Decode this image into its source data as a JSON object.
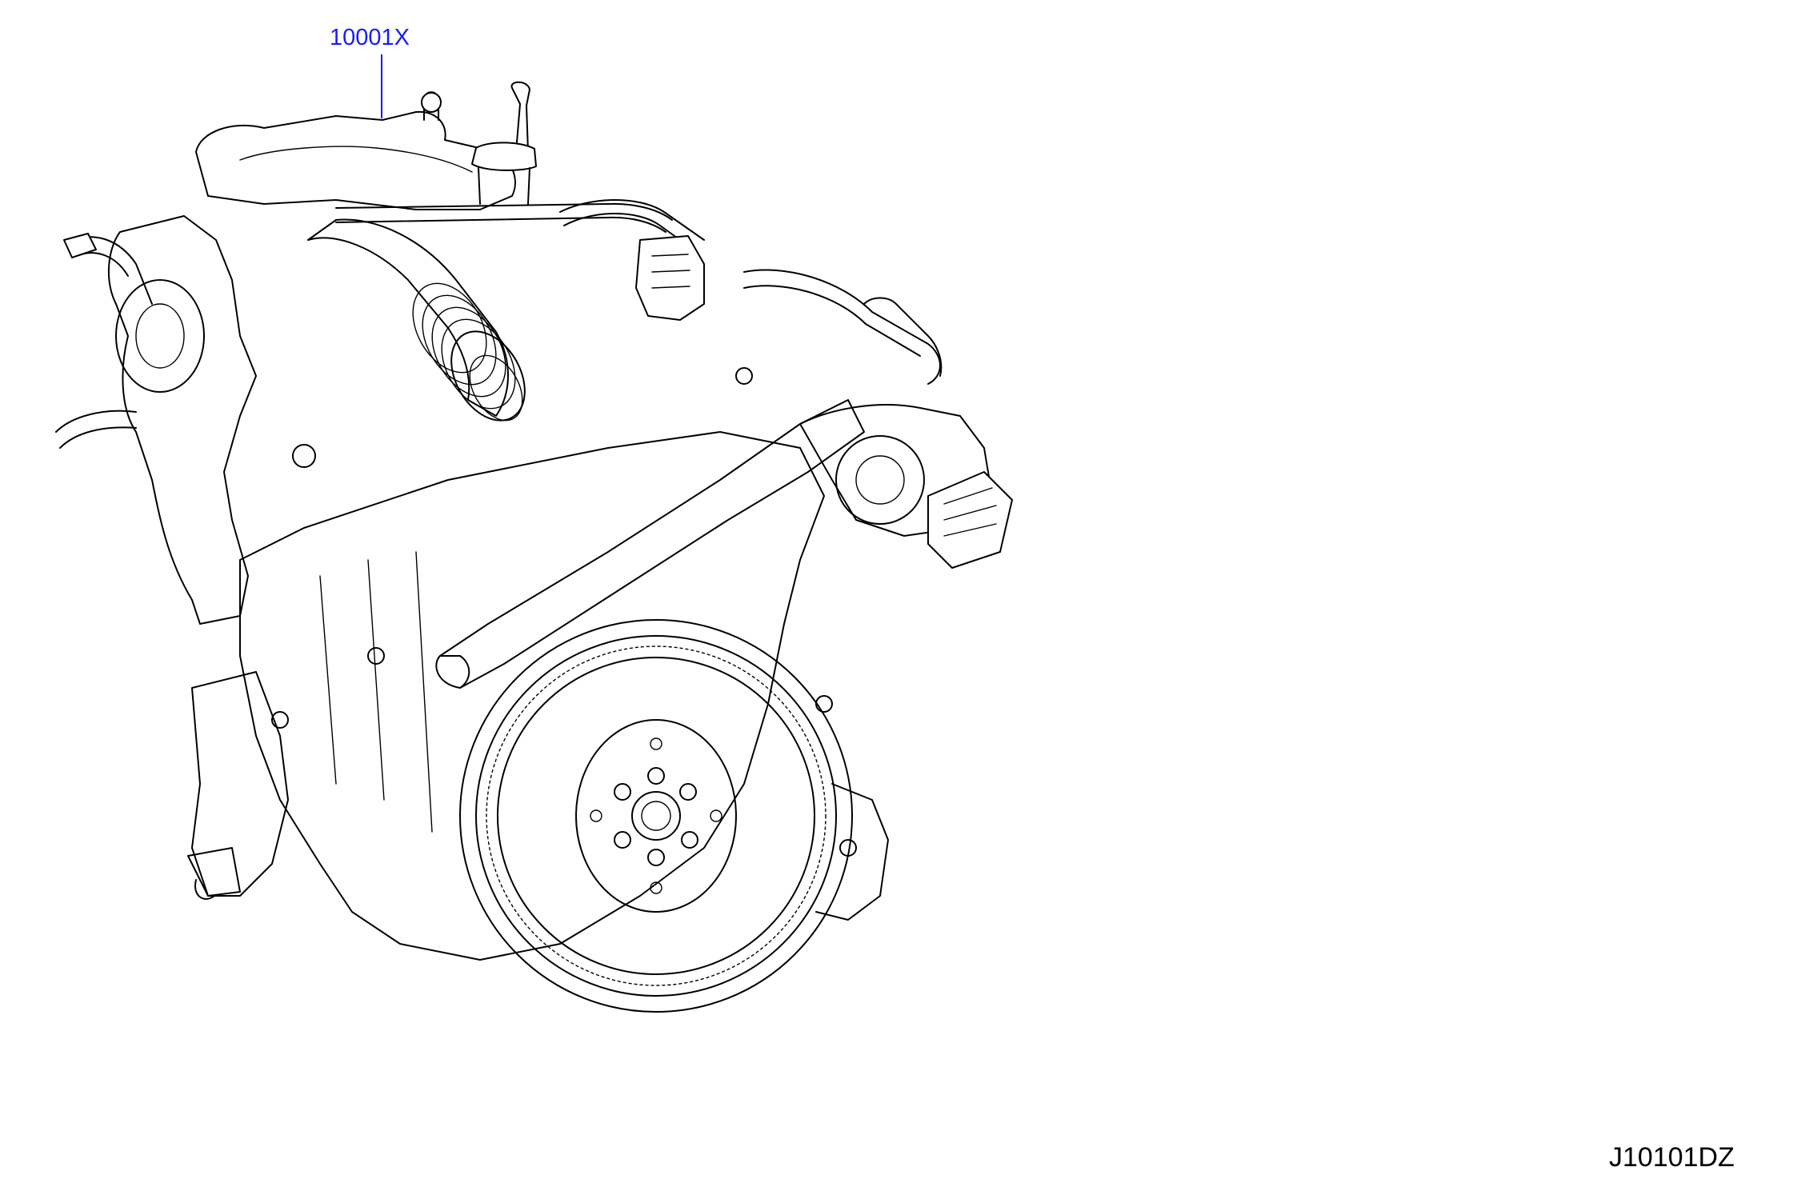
{
  "callouts": [
    {
      "part_number": "10001X",
      "color": "#1a1aff"
    }
  ],
  "figure_code": "J10101DZ",
  "colors": {
    "line": "#000000",
    "callout": "#1a1aff",
    "background": "#ffffff"
  }
}
